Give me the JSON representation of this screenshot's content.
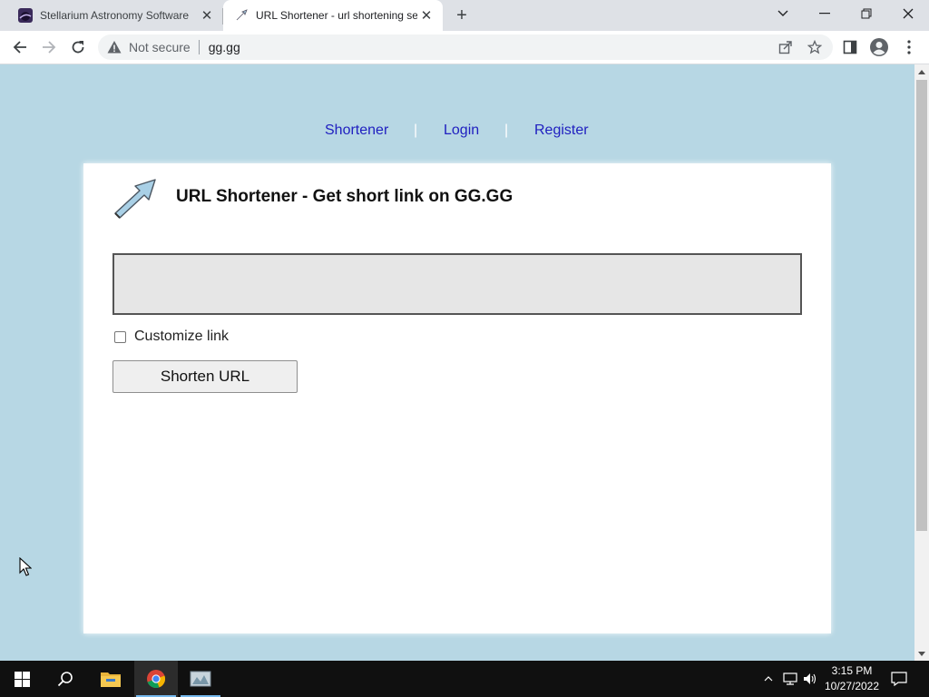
{
  "browser": {
    "tabs": [
      {
        "title": "Stellarium Astronomy Software",
        "active": false
      },
      {
        "title": "URL Shortener - url shortening se",
        "active": true
      }
    ],
    "omnibox": {
      "security_label": "Not secure",
      "url": "gg.gg"
    }
  },
  "page": {
    "nav": {
      "shortener": "Shortener",
      "login": "Login",
      "register": "Register",
      "separator": "|"
    },
    "heading": "URL Shortener - Get short link on GG.GG",
    "url_input": {
      "value": "",
      "placeholder": ""
    },
    "customize_label": "Customize link",
    "customize_checked": false,
    "submit_label": "Shorten URL"
  },
  "taskbar": {
    "time": "3:15 PM",
    "date": "10/27/2022"
  },
  "colors": {
    "page_background": "#b7d7e4",
    "link": "#2020c0",
    "taskbar": "#101010"
  },
  "icons": [
    "stellarium-icon",
    "gg-arrow-icon",
    "back-icon",
    "forward-icon",
    "reload-icon",
    "warning-icon",
    "share-icon",
    "star-icon",
    "sidepanel-icon",
    "profile-icon",
    "menu-icon",
    "windows-start-icon",
    "search-icon",
    "file-explorer-icon",
    "chrome-icon",
    "app-icon",
    "network-icon",
    "volume-icon",
    "notification-icon"
  ]
}
